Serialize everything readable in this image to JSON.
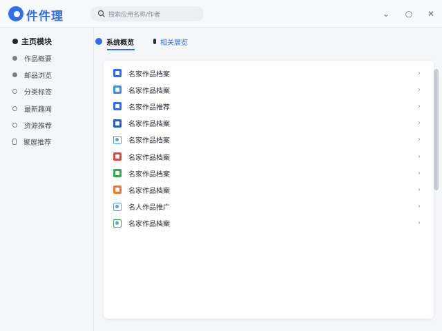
{
  "app": {
    "name": "件件理"
  },
  "search": {
    "placeholder": "搜索应用名称/作者"
  },
  "window": {
    "minimize": "⌄",
    "maximize": "○",
    "close": "✕"
  },
  "sidebar": {
    "heading": "主页模块",
    "items": [
      {
        "label": "作品概要",
        "icon": "dot-icon"
      },
      {
        "label": "邮品浏览",
        "icon": "dot-icon"
      },
      {
        "label": "分类标签",
        "icon": "circle-icon"
      },
      {
        "label": "最新趣闻",
        "icon": "circle-icon"
      },
      {
        "label": "资源推荐",
        "icon": "circle-icon"
      },
      {
        "label": "聚展推荐",
        "icon": "phone-icon"
      }
    ]
  },
  "tabs": [
    {
      "label": "系统概览",
      "active": true
    },
    {
      "label": "相关展览",
      "active": false
    }
  ],
  "list": {
    "rows": [
      {
        "label": "名家作品档案",
        "icon_color": "#2f6df0",
        "icon": "document-icon"
      },
      {
        "label": "名家作品档案",
        "icon_color": "#3a8ee6",
        "icon": "document-icon"
      },
      {
        "label": "名家作品推荐",
        "icon_color": "#2f6df0",
        "icon": "document-icon"
      },
      {
        "label": "名家作品档案",
        "icon_color": "#1f5fd6",
        "icon": "camera-icon"
      },
      {
        "label": "名家作品档案",
        "icon_color": "#5aa0e8",
        "icon": "image-icon",
        "outline": true
      },
      {
        "label": "名家作品档案",
        "icon_color": "#e0473b",
        "icon": "grid-icon"
      },
      {
        "label": "名家作品档案",
        "icon_color": "#2fae4f",
        "icon": "chat-icon"
      },
      {
        "label": "名家作品档案",
        "icon_color": "#f0782b",
        "icon": "font-icon"
      },
      {
        "label": "名人作品推广",
        "icon_color": "#5aa0e8",
        "icon": "image-icon",
        "outline": true
      },
      {
        "label": "名家作品档案",
        "icon_color": "#2fae4f",
        "icon": "list-icon",
        "outline": true
      }
    ],
    "chevron": "›"
  }
}
